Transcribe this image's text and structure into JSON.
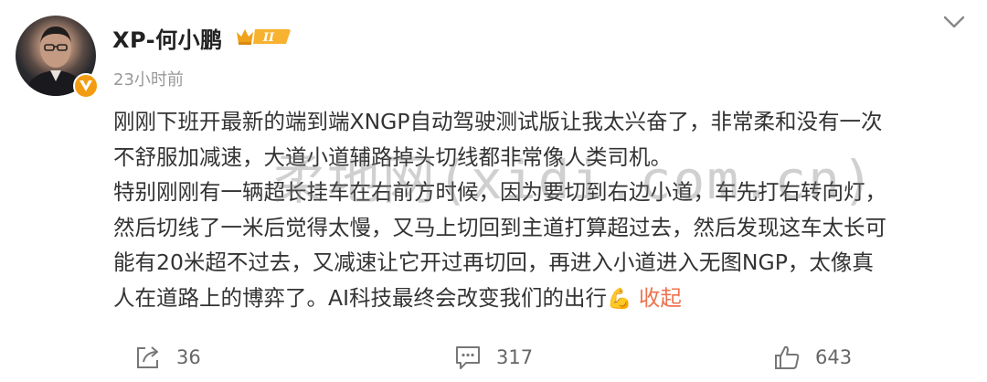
{
  "post": {
    "author": "XP-何小鹏",
    "time": "23小时前",
    "content_lines": [
      "刚刚下班开最新的端到端XNGP自动驾驶测试版让我太兴奋了，非常柔和没有一次",
      "不舒服加减速，大道小道辅路掉头切线都非常像人类司机。",
      "特别刚刚有一辆超长挂车在右前方时候，因为要切到右边小道，车先打右转向灯，",
      "然后切线了一米后觉得太慢，又马上切回到主道打算超过去，然后发现这车太长可",
      "能有20米超不过去，又减速让它开过再切回，再进入小道进入无图NGP，太像真",
      "人在道路上的博弈了。AI科技最终会改变我们的出行"
    ],
    "emoji": "💪",
    "collapse_label": "收起",
    "level_badge": "II",
    "watermark": "柔地网(xidi.com.cn)"
  },
  "actions": {
    "share_count": "36",
    "comment_count": "317",
    "like_count": "643"
  },
  "icons": {
    "avatar": "avatar",
    "verified": "verified-badge-icon",
    "level": "crown-level-icon",
    "more": "chevron-down-icon",
    "share": "share-icon",
    "comment": "comment-icon",
    "like": "thumbs-up-icon"
  },
  "colors": {
    "accent_link": "#eb7350",
    "badge_orange": "#f39c12",
    "text_primary": "#333333",
    "text_secondary": "#999999"
  }
}
